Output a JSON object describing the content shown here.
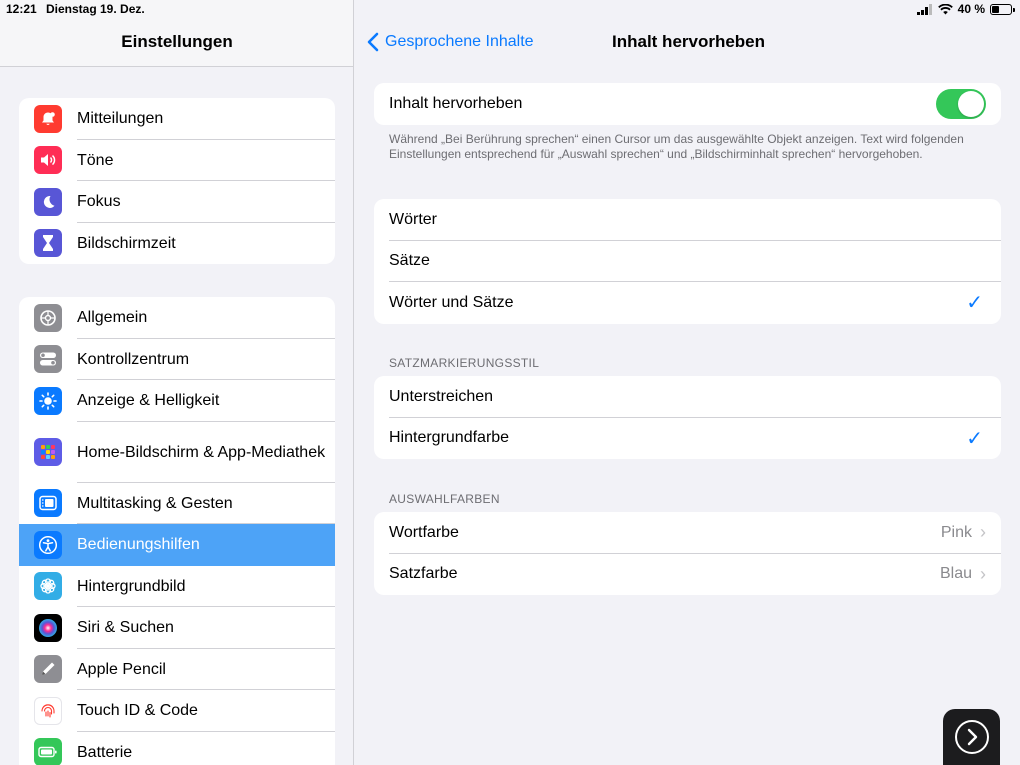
{
  "status": {
    "time": "12:21",
    "date": "Dienstag 19. Dez.",
    "battery": "40 %",
    "battery_level": 0.4
  },
  "sidebar": {
    "title": "Einstellungen",
    "group1": [
      {
        "label": "Mitteilungen",
        "icon": "bell-icon",
        "color": "#ff3b30"
      },
      {
        "label": "Töne",
        "icon": "speaker-icon",
        "color": "#ff2d55"
      },
      {
        "label": "Fokus",
        "icon": "moon-icon",
        "color": "#5856d6"
      },
      {
        "label": "Bildschirmzeit",
        "icon": "hourglass-icon",
        "color": "#5856d6"
      }
    ],
    "group2": [
      {
        "label": "Allgemein",
        "icon": "gear-icon",
        "color": "#8e8e93"
      },
      {
        "label": "Kontrollzentrum",
        "icon": "toggles-icon",
        "color": "#8e8e93"
      },
      {
        "label": "Anzeige & Helligkeit",
        "icon": "sun-icon",
        "color": "#0a7aff"
      },
      {
        "label": "Home-Bildschirm & App-Mediathek",
        "icon": "app-grid-icon",
        "color": "#5e5ce6"
      },
      {
        "label": "Multitasking & Gesten",
        "icon": "multitasking-icon",
        "color": "#0a7aff"
      },
      {
        "label": "Bedienungshilfen",
        "icon": "accessibility-icon",
        "color": "#0a7aff"
      },
      {
        "label": "Hintergrundbild",
        "icon": "flower-icon",
        "color": "#32ade6"
      },
      {
        "label": "Siri & Suchen",
        "icon": "siri-icon",
        "color": "#000000"
      },
      {
        "label": "Apple Pencil",
        "icon": "pencil-icon",
        "color": "#8e8e93"
      },
      {
        "label": "Touch ID & Code",
        "icon": "fingerprint-icon",
        "color": "#ffffff"
      },
      {
        "label": "Batterie",
        "icon": "battery-icon",
        "color": "#34c759"
      }
    ]
  },
  "main": {
    "back_label": "Gesprochene Inhalte",
    "title": "Inhalt hervorheben",
    "toggle_label": "Inhalt hervorheben",
    "toggle_on": true,
    "footnote": "Während „Bei Berührung sprechen“ einen Cursor um das ausgewählte Objekt anzeigen. Text wird folgenden Einstellungen entsprechend für „Auswahl sprechen“ und „Bildschirminhalt sprechen“ hervorgehoben.",
    "mode_options": [
      "Wörter",
      "Sätze",
      "Wörter und Sätze"
    ],
    "mode_check": "✓",
    "style_header": "SATZMARKIERUNGSSTIL",
    "style_options": [
      "Unterstreichen",
      "Hintergrundfarbe"
    ],
    "style_check": "✓",
    "colors_header": "AUSWAHLFARBEN",
    "word_color_label": "Wortfarbe",
    "word_color_value": "Pink",
    "sentence_color_label": "Satzfarbe",
    "sentence_color_value": "Blau",
    "chevron": "›"
  }
}
